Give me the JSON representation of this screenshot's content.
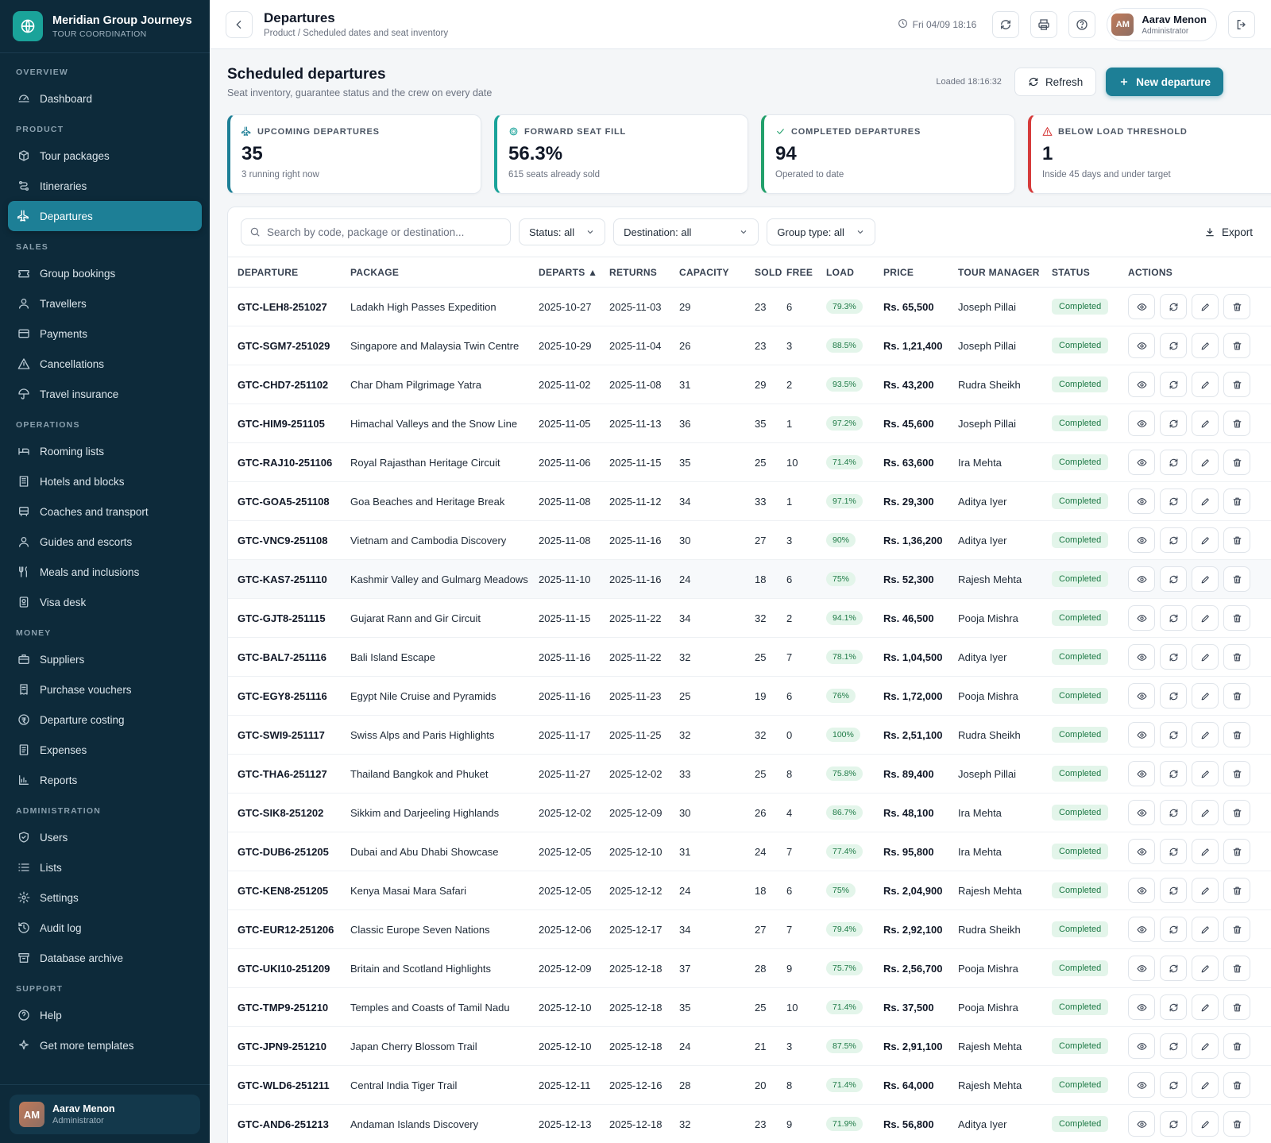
{
  "brand": {
    "name": "Meridian Group Journeys",
    "subtitle": "TOUR COORDINATION"
  },
  "nav": [
    {
      "section": "OVERVIEW",
      "items": [
        {
          "label": "Dashboard",
          "icon": "dashboard-icon"
        }
      ]
    },
    {
      "section": "PRODUCT",
      "items": [
        {
          "label": "Tour packages",
          "icon": "package-icon"
        },
        {
          "label": "Itineraries",
          "icon": "route-icon"
        },
        {
          "label": "Departures",
          "icon": "plane-icon",
          "active": true
        }
      ]
    },
    {
      "section": "SALES",
      "items": [
        {
          "label": "Group bookings",
          "icon": "ticket-icon"
        },
        {
          "label": "Travellers",
          "icon": "user-icon"
        },
        {
          "label": "Payments",
          "icon": "card-icon"
        },
        {
          "label": "Cancellations",
          "icon": "warning-icon"
        },
        {
          "label": "Travel insurance",
          "icon": "umbrella-icon"
        }
      ]
    },
    {
      "section": "OPERATIONS",
      "items": [
        {
          "label": "Rooming lists",
          "icon": "bed-icon"
        },
        {
          "label": "Hotels and blocks",
          "icon": "building-icon"
        },
        {
          "label": "Coaches and transport",
          "icon": "bus-icon"
        },
        {
          "label": "Guides and escorts",
          "icon": "user-icon"
        },
        {
          "label": "Meals and inclusions",
          "icon": "utensils-icon"
        },
        {
          "label": "Visa desk",
          "icon": "passport-icon"
        }
      ]
    },
    {
      "section": "MONEY",
      "items": [
        {
          "label": "Suppliers",
          "icon": "briefcase-icon"
        },
        {
          "label": "Purchase vouchers",
          "icon": "receipt-icon"
        },
        {
          "label": "Departure costing",
          "icon": "coin-icon"
        },
        {
          "label": "Expenses",
          "icon": "document-icon"
        },
        {
          "label": "Reports",
          "icon": "chart-icon"
        }
      ]
    },
    {
      "section": "ADMINISTRATION",
      "items": [
        {
          "label": "Users",
          "icon": "shield-icon"
        },
        {
          "label": "Lists",
          "icon": "list-icon"
        },
        {
          "label": "Settings",
          "icon": "gear-icon"
        },
        {
          "label": "Audit log",
          "icon": "history-icon"
        },
        {
          "label": "Database archive",
          "icon": "archive-icon"
        }
      ]
    },
    {
      "section": "SUPPORT",
      "items": [
        {
          "label": "Help",
          "icon": "help-icon"
        },
        {
          "label": "Get more templates",
          "icon": "sparkle-icon"
        }
      ]
    }
  ],
  "sidebar_user": {
    "initials": "AM",
    "name": "Aarav Menon",
    "role": "Administrator"
  },
  "topbar": {
    "title": "Departures",
    "breadcrumb": "Product / Scheduled dates and seat inventory",
    "datetime": "Fri 04/09 18:16",
    "user": {
      "initials": "AM",
      "name": "Aarav Menon",
      "role": "Administrator"
    }
  },
  "main": {
    "title": "Scheduled departures",
    "subtitle": "Seat inventory, guarantee status and the crew on every date",
    "loaded": "Loaded 18:16:32",
    "refresh_label": "Refresh",
    "new_label": "New departure"
  },
  "kpis": [
    {
      "label": "UPCOMING DEPARTURES",
      "value": "35",
      "note": "3 running right now",
      "color": "#1d7f96",
      "icon": "plane-icon"
    },
    {
      "label": "FORWARD SEAT FILL",
      "value": "56.3%",
      "note": "615 seats already sold",
      "color": "#1aa39a",
      "icon": "target-icon"
    },
    {
      "label": "COMPLETED DEPARTURES",
      "value": "94",
      "note": "Operated to date",
      "color": "#22a06b",
      "icon": "check-icon"
    },
    {
      "label": "BELOW LOAD THRESHOLD",
      "value": "1",
      "note": "Inside 45 days and under target",
      "color": "#d63b3b",
      "icon": "alert-icon"
    }
  ],
  "filters": {
    "search_placeholder": "Search by code, package or destination...",
    "status": "Status: all",
    "destination": "Destination: all",
    "group_type": "Group type: all",
    "export_label": "Export"
  },
  "columns": [
    "DEPARTURE",
    "PACKAGE",
    "DEPARTS ▲",
    "RETURNS",
    "CAPACITY",
    "SOLD",
    "FREE",
    "LOAD",
    "PRICE",
    "TOUR MANAGER",
    "STATUS",
    "ACTIONS"
  ],
  "rows": [
    {
      "code": "GTC-LEH8-251027",
      "package": "Ladakh High Passes Expedition",
      "departs": "2025-10-27",
      "returns": "2025-11-03",
      "capacity": "29",
      "sold": "23",
      "free": "6",
      "load": "79.3%",
      "price": "Rs. 65,500",
      "manager": "Joseph Pillai",
      "status": "Completed"
    },
    {
      "code": "GTC-SGM7-251029",
      "package": "Singapore and Malaysia Twin Centre",
      "departs": "2025-10-29",
      "returns": "2025-11-04",
      "capacity": "26",
      "sold": "23",
      "free": "3",
      "load": "88.5%",
      "price": "Rs. 1,21,400",
      "manager": "Joseph Pillai",
      "status": "Completed"
    },
    {
      "code": "GTC-CHD7-251102",
      "package": "Char Dham Pilgrimage Yatra",
      "departs": "2025-11-02",
      "returns": "2025-11-08",
      "capacity": "31",
      "sold": "29",
      "free": "2",
      "load": "93.5%",
      "price": "Rs. 43,200",
      "manager": "Rudra Sheikh",
      "status": "Completed"
    },
    {
      "code": "GTC-HIM9-251105",
      "package": "Himachal Valleys and the Snow Line",
      "departs": "2025-11-05",
      "returns": "2025-11-13",
      "capacity": "36",
      "sold": "35",
      "free": "1",
      "load": "97.2%",
      "price": "Rs. 45,600",
      "manager": "Joseph Pillai",
      "status": "Completed"
    },
    {
      "code": "GTC-RAJ10-251106",
      "package": "Royal Rajasthan Heritage Circuit",
      "departs": "2025-11-06",
      "returns": "2025-11-15",
      "capacity": "35",
      "sold": "25",
      "free": "10",
      "load": "71.4%",
      "price": "Rs. 63,600",
      "manager": "Ira Mehta",
      "status": "Completed"
    },
    {
      "code": "GTC-GOA5-251108",
      "package": "Goa Beaches and Heritage Break",
      "departs": "2025-11-08",
      "returns": "2025-11-12",
      "capacity": "34",
      "sold": "33",
      "free": "1",
      "load": "97.1%",
      "price": "Rs. 29,300",
      "manager": "Aditya Iyer",
      "status": "Completed"
    },
    {
      "code": "GTC-VNC9-251108",
      "package": "Vietnam and Cambodia Discovery",
      "departs": "2025-11-08",
      "returns": "2025-11-16",
      "capacity": "30",
      "sold": "27",
      "free": "3",
      "load": "90%",
      "price": "Rs. 1,36,200",
      "manager": "Aditya Iyer",
      "status": "Completed"
    },
    {
      "code": "GTC-KAS7-251110",
      "package": "Kashmir Valley and Gulmarg Meadows",
      "departs": "2025-11-10",
      "returns": "2025-11-16",
      "capacity": "24",
      "sold": "18",
      "free": "6",
      "load": "75%",
      "price": "Rs. 52,300",
      "manager": "Rajesh Mehta",
      "status": "Completed",
      "highlight": true
    },
    {
      "code": "GTC-GJT8-251115",
      "package": "Gujarat Rann and Gir Circuit",
      "departs": "2025-11-15",
      "returns": "2025-11-22",
      "capacity": "34",
      "sold": "32",
      "free": "2",
      "load": "94.1%",
      "price": "Rs. 46,500",
      "manager": "Pooja Mishra",
      "status": "Completed"
    },
    {
      "code": "GTC-BAL7-251116",
      "package": "Bali Island Escape",
      "departs": "2025-11-16",
      "returns": "2025-11-22",
      "capacity": "32",
      "sold": "25",
      "free": "7",
      "load": "78.1%",
      "price": "Rs. 1,04,500",
      "manager": "Aditya Iyer",
      "status": "Completed"
    },
    {
      "code": "GTC-EGY8-251116",
      "package": "Egypt Nile Cruise and Pyramids",
      "departs": "2025-11-16",
      "returns": "2025-11-23",
      "capacity": "25",
      "sold": "19",
      "free": "6",
      "load": "76%",
      "price": "Rs. 1,72,000",
      "manager": "Pooja Mishra",
      "status": "Completed"
    },
    {
      "code": "GTC-SWI9-251117",
      "package": "Swiss Alps and Paris Highlights",
      "departs": "2025-11-17",
      "returns": "2025-11-25",
      "capacity": "32",
      "sold": "32",
      "free": "0",
      "load": "100%",
      "price": "Rs. 2,51,100",
      "manager": "Rudra Sheikh",
      "status": "Completed"
    },
    {
      "code": "GTC-THA6-251127",
      "package": "Thailand Bangkok and Phuket",
      "departs": "2025-11-27",
      "returns": "2025-12-02",
      "capacity": "33",
      "sold": "25",
      "free": "8",
      "load": "75.8%",
      "price": "Rs. 89,400",
      "manager": "Joseph Pillai",
      "status": "Completed"
    },
    {
      "code": "GTC-SIK8-251202",
      "package": "Sikkim and Darjeeling Highlands",
      "departs": "2025-12-02",
      "returns": "2025-12-09",
      "capacity": "30",
      "sold": "26",
      "free": "4",
      "load": "86.7%",
      "price": "Rs. 48,100",
      "manager": "Ira Mehta",
      "status": "Completed"
    },
    {
      "code": "GTC-DUB6-251205",
      "package": "Dubai and Abu Dhabi Showcase",
      "departs": "2025-12-05",
      "returns": "2025-12-10",
      "capacity": "31",
      "sold": "24",
      "free": "7",
      "load": "77.4%",
      "price": "Rs. 95,800",
      "manager": "Ira Mehta",
      "status": "Completed"
    },
    {
      "code": "GTC-KEN8-251205",
      "package": "Kenya Masai Mara Safari",
      "departs": "2025-12-05",
      "returns": "2025-12-12",
      "capacity": "24",
      "sold": "18",
      "free": "6",
      "load": "75%",
      "price": "Rs. 2,04,900",
      "manager": "Rajesh Mehta",
      "status": "Completed"
    },
    {
      "code": "GTC-EUR12-251206",
      "package": "Classic Europe Seven Nations",
      "departs": "2025-12-06",
      "returns": "2025-12-17",
      "capacity": "34",
      "sold": "27",
      "free": "7",
      "load": "79.4%",
      "price": "Rs. 2,92,100",
      "manager": "Rudra Sheikh",
      "status": "Completed"
    },
    {
      "code": "GTC-UKI10-251209",
      "package": "Britain and Scotland Highlights",
      "departs": "2025-12-09",
      "returns": "2025-12-18",
      "capacity": "37",
      "sold": "28",
      "free": "9",
      "load": "75.7%",
      "price": "Rs. 2,56,700",
      "manager": "Pooja Mishra",
      "status": "Completed"
    },
    {
      "code": "GTC-TMP9-251210",
      "package": "Temples and Coasts of Tamil Nadu",
      "departs": "2025-12-10",
      "returns": "2025-12-18",
      "capacity": "35",
      "sold": "25",
      "free": "10",
      "load": "71.4%",
      "price": "Rs. 37,500",
      "manager": "Pooja Mishra",
      "status": "Completed"
    },
    {
      "code": "GTC-JPN9-251210",
      "package": "Japan Cherry Blossom Trail",
      "departs": "2025-12-10",
      "returns": "2025-12-18",
      "capacity": "24",
      "sold": "21",
      "free": "3",
      "load": "87.5%",
      "price": "Rs. 2,91,100",
      "manager": "Rajesh Mehta",
      "status": "Completed"
    },
    {
      "code": "GTC-WLD6-251211",
      "package": "Central India Tiger Trail",
      "departs": "2025-12-11",
      "returns": "2025-12-16",
      "capacity": "28",
      "sold": "20",
      "free": "8",
      "load": "71.4%",
      "price": "Rs. 64,000",
      "manager": "Rajesh Mehta",
      "status": "Completed"
    },
    {
      "code": "GTC-AND6-251213",
      "package": "Andaman Islands Discovery",
      "departs": "2025-12-13",
      "returns": "2025-12-18",
      "capacity": "32",
      "sold": "23",
      "free": "9",
      "load": "71.9%",
      "price": "Rs. 56,800",
      "manager": "Aditya Iyer",
      "status": "Completed"
    }
  ]
}
